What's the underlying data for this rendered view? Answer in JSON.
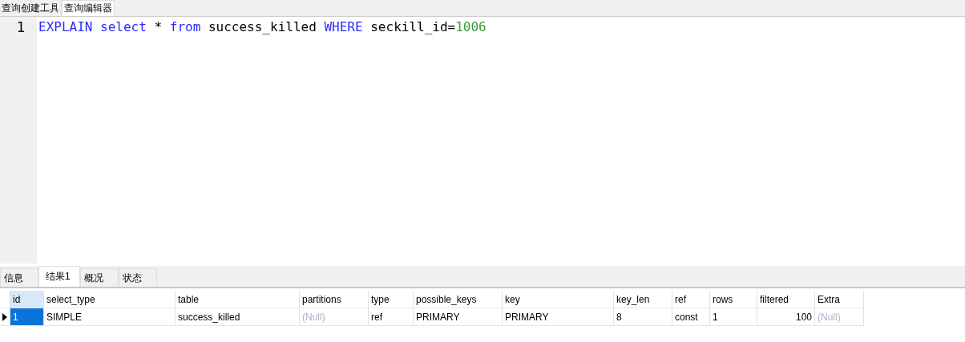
{
  "top_tabs": [
    {
      "label": "查询创建工具",
      "selected": false
    },
    {
      "label": "查询编辑器",
      "selected": true
    }
  ],
  "editor": {
    "lines": [
      {
        "number": "1",
        "tokens": [
          {
            "text": "EXPLAIN ",
            "kind": "keyword"
          },
          {
            "text": "select ",
            "kind": "keyword"
          },
          {
            "text": "* ",
            "kind": "plain"
          },
          {
            "text": "from ",
            "kind": "keyword"
          },
          {
            "text": "success_killed ",
            "kind": "plain"
          },
          {
            "text": "WHERE ",
            "kind": "keyword"
          },
          {
            "text": "seckill_id=",
            "kind": "plain"
          },
          {
            "text": "1006",
            "kind": "number"
          }
        ]
      }
    ]
  },
  "result_tabs": [
    {
      "label": "信息",
      "selected": false
    },
    {
      "label": "结果1",
      "selected": true
    },
    {
      "label": "概况",
      "selected": false
    },
    {
      "label": "状态",
      "selected": false
    }
  ],
  "table": {
    "columns": [
      {
        "label": "id",
        "selected": true
      },
      {
        "label": "select_type",
        "selected": false
      },
      {
        "label": "table",
        "selected": false
      },
      {
        "label": "partitions",
        "selected": false
      },
      {
        "label": "type",
        "selected": false
      },
      {
        "label": "possible_keys",
        "selected": false
      },
      {
        "label": "key",
        "selected": false
      },
      {
        "label": "key_len",
        "selected": false
      },
      {
        "label": "ref",
        "selected": false
      },
      {
        "label": "rows",
        "selected": false
      },
      {
        "label": "filtered",
        "selected": false
      },
      {
        "label": "Extra",
        "selected": false
      }
    ],
    "rows": [
      {
        "selected": true,
        "cells": [
          {
            "text": "1",
            "kind": "number"
          },
          {
            "text": "SIMPLE",
            "kind": "text"
          },
          {
            "text": "success_killed",
            "kind": "text"
          },
          {
            "text": "(Null)",
            "kind": "null"
          },
          {
            "text": "ref",
            "kind": "text"
          },
          {
            "text": "PRIMARY",
            "kind": "text"
          },
          {
            "text": "PRIMARY",
            "kind": "text"
          },
          {
            "text": "8",
            "kind": "text"
          },
          {
            "text": "const",
            "kind": "text"
          },
          {
            "text": "1",
            "kind": "text"
          },
          {
            "text": "100",
            "kind": "number"
          },
          {
            "text": "(Null)",
            "kind": "null"
          }
        ]
      }
    ]
  }
}
